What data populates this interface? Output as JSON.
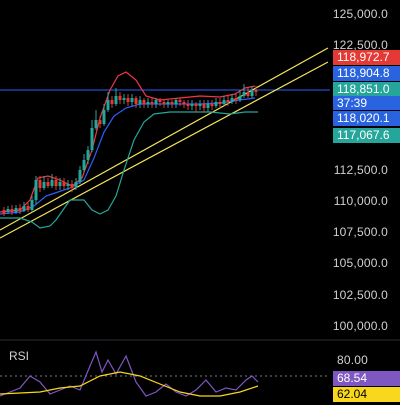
{
  "price_axis": {
    "labels": [
      "125,000.0",
      "122,500.0",
      "112,500.0",
      "110,000.0",
      "107,500.0",
      "105,000.0",
      "102,500.0",
      "100,000.0"
    ]
  },
  "price_tags": [
    {
      "value": "118,972.7",
      "color": "#e53935",
      "text_color": "#ffffff"
    },
    {
      "value": "118,904.8",
      "color": "#2a63e0",
      "text_color": "#ffffff"
    },
    {
      "value": "118,851.0",
      "color": "#26a69a",
      "text_color": "#ffffff"
    },
    {
      "value": "118,020.1",
      "color": "#2a63e0",
      "text_color": "#ffffff"
    },
    {
      "value": "117,067.6",
      "color": "#26a69a",
      "text_color": "#ffffff"
    }
  ],
  "countdown": "37:39",
  "rsi": {
    "title": "RSI",
    "level_label": "80.00",
    "value1": {
      "value": "68.54",
      "color": "#7e57c2"
    },
    "value2": {
      "value": "62.04",
      "color": "#f9d71c"
    }
  },
  "colors": {
    "bull": "#26a69a",
    "bear": "#e53935",
    "bb_upper": "#f23645",
    "bb_lower": "#26a69a",
    "bb_basis": "#2962ff",
    "trend": "#f5e65a",
    "hline": "#2962ff",
    "rsi_line": "#7e57c2",
    "rsi_ma": "#f9d71c"
  },
  "icons": [
    "candlestick-chart",
    "trendline-channel",
    "bollinger-bands",
    "rsi-indicator"
  ]
}
